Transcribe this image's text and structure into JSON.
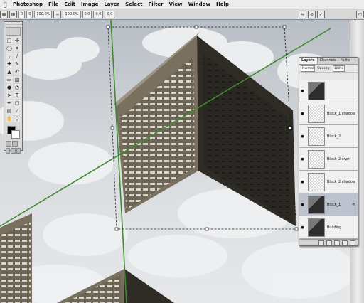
{
  "menubar": {
    "app_name": "Photoshop",
    "items": [
      "File",
      "Edit",
      "Image",
      "Layer",
      "Select",
      "Filter",
      "View",
      "Window",
      "Help"
    ]
  },
  "options_bar": {
    "fields": [
      "0",
      "0",
      "100.0%",
      "0",
      "100.0%",
      "0.0",
      "0.0",
      "0.0"
    ]
  },
  "layers_panel": {
    "tabs": [
      "Layers",
      "Channels",
      "Paths"
    ],
    "blend_mode": "Normal",
    "opacity_label": "Opacity:",
    "opacity_value": "100%",
    "layers": [
      {
        "name": "",
        "visible": true,
        "selected": false,
        "thumb": "building"
      },
      {
        "name": "Block_1 shadow",
        "visible": true,
        "selected": false,
        "thumb": "transparent"
      },
      {
        "name": "Block_2",
        "visible": true,
        "selected": false,
        "thumb": "transparent"
      },
      {
        "name": "Block_2 over",
        "visible": true,
        "selected": false,
        "thumb": "transparent"
      },
      {
        "name": "Block_2 shadow",
        "visible": true,
        "selected": false,
        "thumb": "transparent"
      },
      {
        "name": "Block_1",
        "visible": true,
        "selected": true,
        "thumb": "building"
      },
      {
        "name": "Building",
        "visible": true,
        "selected": false,
        "thumb": "building"
      }
    ]
  },
  "colors": {
    "guide_green": "#3f8a2e",
    "selection_layer": "#bcc3cf",
    "building_dark": "#2c2a24",
    "building_light": "#8b8070"
  },
  "icons": [
    "apple-icon",
    "move-tool-icon",
    "marquee-tool-icon",
    "lasso-tool-icon",
    "brush-tool-icon",
    "eye-icon",
    "link-icon"
  ]
}
